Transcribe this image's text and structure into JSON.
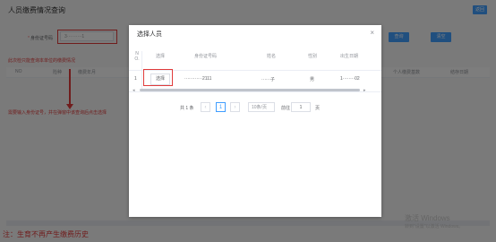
{
  "page": {
    "title": "人员缴费情况查询",
    "top_right_button": "返回",
    "form_label_required": "*",
    "form_label": "身份证号码",
    "id_input_value": "3··········1",
    "query_button": "查询",
    "clear_button": "清空"
  },
  "annotations": {
    "top": "此次检只能查询本单位的缴费情况",
    "middle": "需要输入身份证号，并在弹窗中该查询后点击选择",
    "footer": "注：生育不再产生缴费历史"
  },
  "background_table": {
    "headers": [
      "NO",
      "险种",
      "缴费年月",
      "个人缴费基数",
      "结存日期"
    ]
  },
  "modal": {
    "title": "选择人员",
    "close_icon": "×",
    "columns": [
      "N O.",
      "选择",
      "身份证号码",
      "姓名",
      "性别",
      "出生日期"
    ],
    "row": {
      "no": "1",
      "select": "选择",
      "id": "············2111",
      "name": "······子",
      "gender": "男",
      "birth": "1········02"
    },
    "pagination": {
      "total": "共 1 条",
      "prev_icon": "‹",
      "current_page": "1",
      "next_icon": "›",
      "page_size": "10条/页",
      "goto_label": "前往",
      "goto_value": "1",
      "page_suffix": "页"
    }
  },
  "watermark": {
    "line1": "激活 Windows",
    "line2": "转到\"设置\"以激活 Windows。"
  },
  "colors": {
    "primary": "#409eff",
    "annotation_red": "#e03b3b"
  }
}
